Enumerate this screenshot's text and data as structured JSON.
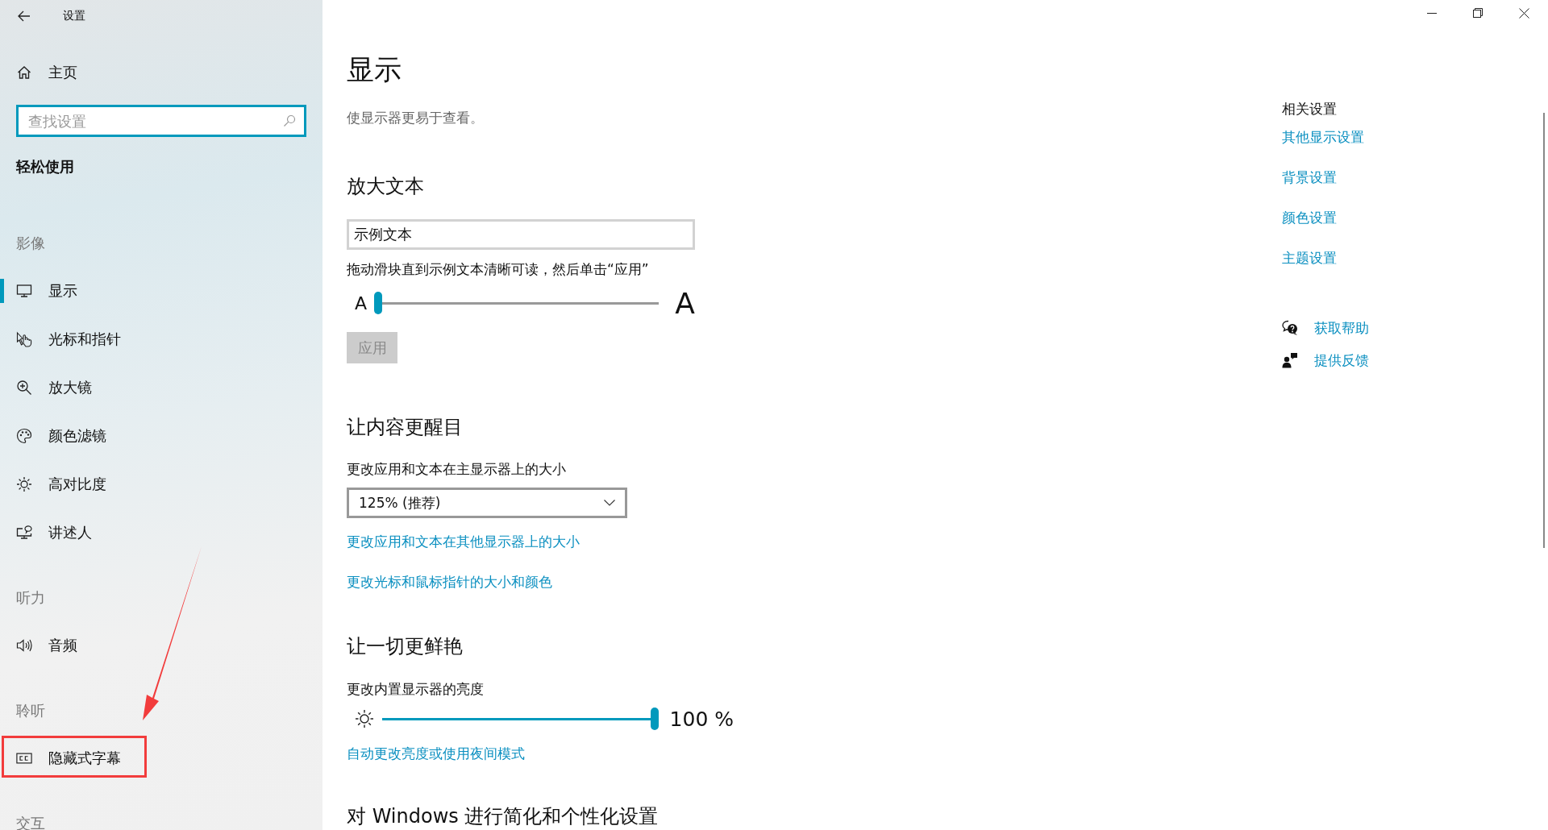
{
  "window": {
    "title": "设置"
  },
  "sidebar": {
    "home": "主页",
    "search": {
      "placeholder": "查找设置"
    },
    "category": "轻松使用",
    "groups": [
      {
        "heading": "影像",
        "items": [
          {
            "label": "显示",
            "selected": true,
            "marked": false
          },
          {
            "label": "光标和指针",
            "selected": false,
            "marked": false
          },
          {
            "label": "放大镜",
            "selected": false,
            "marked": false
          },
          {
            "label": "颜色滤镜",
            "selected": false,
            "marked": false
          },
          {
            "label": "高对比度",
            "selected": false,
            "marked": false
          },
          {
            "label": "讲述人",
            "selected": false,
            "marked": false
          }
        ]
      },
      {
        "heading": "听力",
        "items": [
          {
            "label": "音频",
            "selected": false,
            "marked": false
          }
        ]
      },
      {
        "heading": "聆听",
        "items": [
          {
            "label": "隐藏式字幕",
            "selected": false,
            "marked": true
          }
        ]
      },
      {
        "heading": "交互"
      }
    ]
  },
  "page": {
    "title": "显示",
    "subtitle": "使显示器更易于查看。"
  },
  "text_size": {
    "heading": "放大文本",
    "sample": "示例文本",
    "hint": "拖动滑块直到示例文本清晰可读，然后单击“应用”",
    "small_a": "A",
    "large_a": "A",
    "level": 0,
    "apply": {
      "label": "应用",
      "disabled": true
    }
  },
  "prominence": {
    "heading": "让内容更醒目",
    "scale_label": "更改应用和文本在主显示器上的大小",
    "scale_value": "125% (推荐)",
    "links": [
      "更改应用和文本在其他显示器上的大小",
      "更改光标和鼠标指针的大小和颜色"
    ]
  },
  "brightness": {
    "heading": "让一切更鲜艳",
    "label": "更改内置显示器的亮度",
    "level": 1,
    "reading": "100 %",
    "link": "自动更改亮度或使用夜间模式"
  },
  "next_heading": "对 Windows 进行简化和个性化设置",
  "related": {
    "heading": "相关设置",
    "links": [
      "其他显示设置",
      "背景设置",
      "颜色设置",
      "主题设置"
    ],
    "help": [
      {
        "kind": "help",
        "label": "获取帮助"
      },
      {
        "kind": "feedback",
        "label": "提供反馈"
      }
    ]
  }
}
